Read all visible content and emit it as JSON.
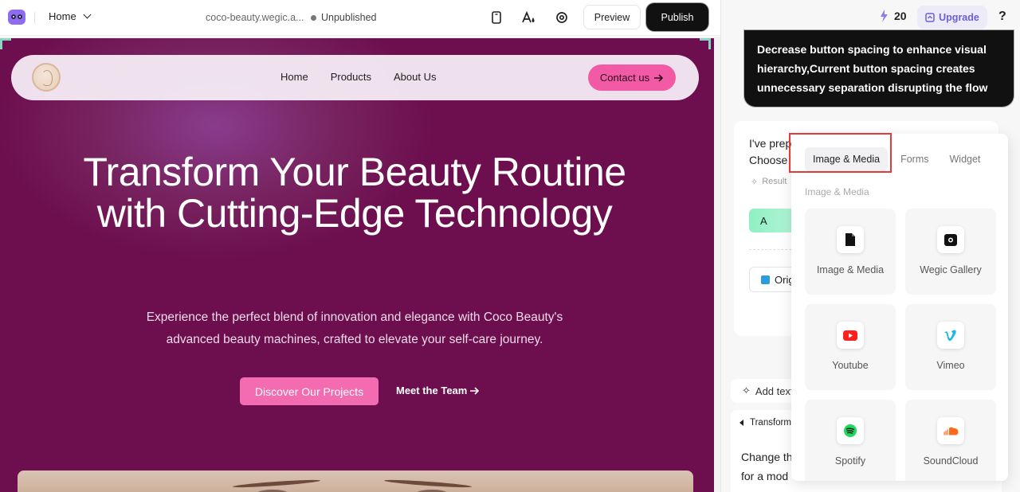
{
  "topbar": {
    "page_select": "Home",
    "domain": "coco-beauty.wegic.a...",
    "status": "Unpublished",
    "preview_label": "Preview",
    "publish_label": "Publish",
    "icons": [
      "mobile-icon",
      "font-style-icon",
      "settings-icon"
    ]
  },
  "site": {
    "nav": {
      "links": [
        "Home",
        "Products",
        "About Us"
      ],
      "contact_label": "Contact us"
    },
    "hero": {
      "title": "Transform Your Beauty Routine with Cutting-Edge Technology",
      "subtitle": "Experience the perfect blend of innovation and elegance with Coco Beauty's advanced beauty machines, crafted to elevate your self-care journey.",
      "primary_cta": "Discover Our Projects",
      "secondary_cta": "Meet the Team"
    },
    "colors": {
      "background": "#6d0f4f",
      "accent": "#f36bb0"
    }
  },
  "panel": {
    "credits": "20",
    "upgrade_label": "Upgrade",
    "help_label": "?",
    "message": "Decrease button spacing to enhance visual hierarchy,Current button spacing creates unnecessary separation disrupting the flow",
    "card": {
      "line1": "I've prep",
      "line2": "Choose",
      "result_label": "Result",
      "option_label": "A",
      "original_label": "Orig"
    },
    "add_text_label": "Add text",
    "transform_card": {
      "title": "Transform",
      "line1": "Change th",
      "line2": "for a mod"
    }
  },
  "popup": {
    "tabs": [
      "Image & Media",
      "Forms",
      "Widget"
    ],
    "active_tab": "Image & Media",
    "section_label": "Image & Media",
    "items": [
      {
        "label": "Image & Media",
        "icon": "file-icon"
      },
      {
        "label": "Wegic Gallery",
        "icon": "gallery-icon"
      },
      {
        "label": "Youtube",
        "icon": "youtube-icon"
      },
      {
        "label": "Vimeo",
        "icon": "vimeo-icon"
      },
      {
        "label": "Spotify",
        "icon": "spotify-icon"
      },
      {
        "label": "SoundCloud",
        "icon": "soundcloud-icon"
      }
    ]
  }
}
